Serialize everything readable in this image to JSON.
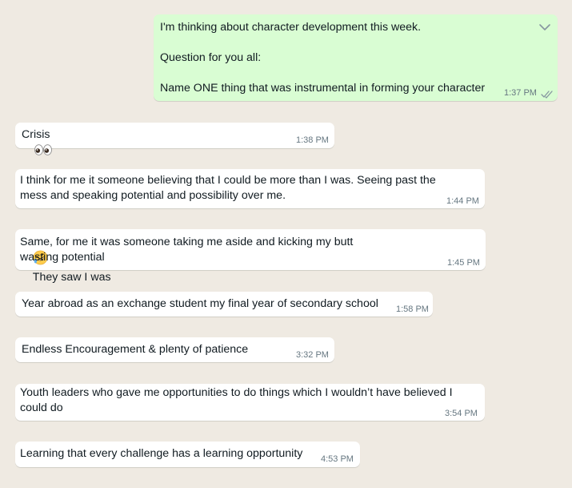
{
  "colors": {
    "background": "#efeae2",
    "incoming_bubble": "#ffffff",
    "outgoing_bubble": "#d9fdd3",
    "timestamp": "#667781",
    "read_ticks": "#8696a0"
  },
  "messages": [
    {
      "direction": "outgoing",
      "lines": [
        "I'm thinking about character development this week.",
        "",
        "Question for you all:",
        "",
        "Name ONE thing that was instrumental in forming your character"
      ],
      "time": "1:37 PM",
      "status_icon": "double-check-icon",
      "menu_icon": "chevron-down-icon"
    },
    {
      "direction": "incoming",
      "text": "Crisis",
      "emoji": "eyes-emoji",
      "time": "1:38 PM"
    },
    {
      "direction": "incoming",
      "lines": [
        "I think for me it someone believing that I could be more than I was. Seeing past the",
        "mess and speaking potential and possibility over me."
      ],
      "time": "1:44 PM"
    },
    {
      "direction": "incoming",
      "line1_before": "Same, for me it was someone taking me aside and kicking my butt",
      "emoji": "rolling-laughing-emoji",
      "line1_after": "They saw I was",
      "line2": "wasting potential",
      "time": "1:45 PM"
    },
    {
      "direction": "incoming",
      "text": "Year abroad as an exchange student my final year of secondary school",
      "time": "1:58 PM"
    },
    {
      "direction": "incoming",
      "text": "Endless Encouragement & plenty of patience",
      "time": "3:32 PM"
    },
    {
      "direction": "incoming",
      "lines": [
        "Youth leaders who gave me opportunities to do things which I wouldn’t have believed I",
        "could do"
      ],
      "time": "3:54 PM"
    },
    {
      "direction": "incoming",
      "text": "Learning that every challenge has a learning opportunity",
      "time": "4:53 PM"
    }
  ]
}
